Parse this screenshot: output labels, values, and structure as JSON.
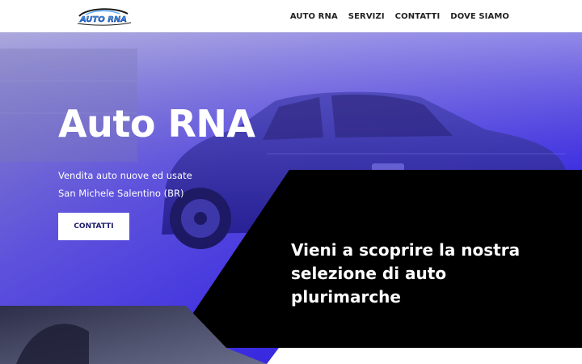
{
  "header": {
    "logo_text": "AUTO RNA",
    "nav": [
      {
        "label": "AUTO RNA"
      },
      {
        "label": "SERVIZI"
      },
      {
        "label": "CONTATTI"
      },
      {
        "label": "DOVE SIAMO"
      }
    ]
  },
  "hero": {
    "title": "Auto RNA",
    "subtitle_line1": "Vendita auto nuove ed usate",
    "subtitle_line2": "San Michele Salentino (BR)",
    "button_label": "CONTATTI",
    "tagline": "Vieni a scoprire la nostra selezione di auto plurimarche"
  },
  "colors": {
    "accent_blue": "#3b2fd6",
    "overlay_black": "#000000",
    "button_text": "#1b1b6b"
  }
}
